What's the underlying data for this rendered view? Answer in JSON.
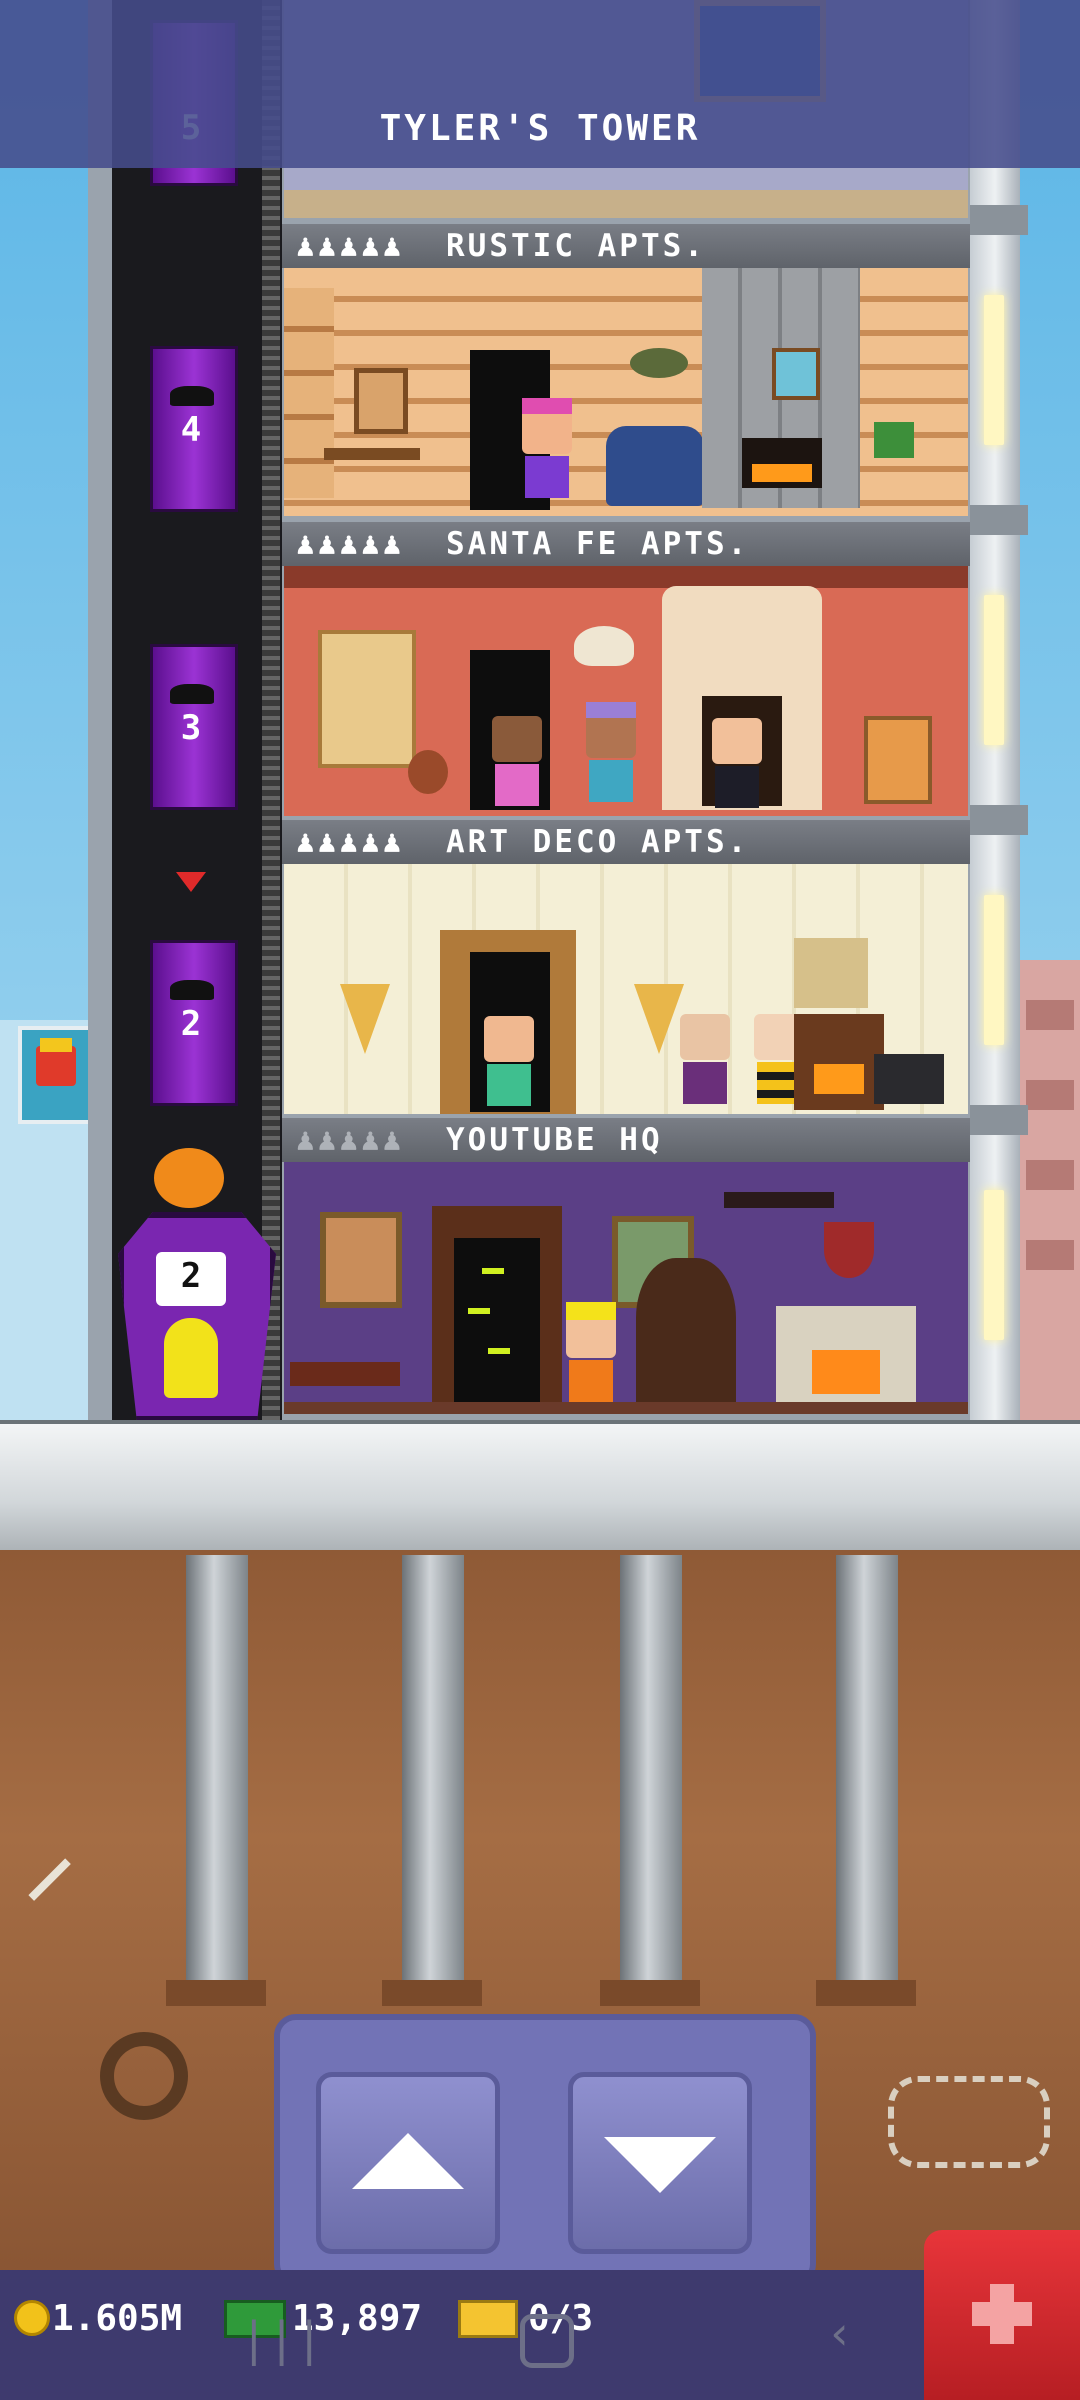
{
  "tower": {
    "title": "TYLER'S TOWER"
  },
  "floors": [
    {
      "people": "♟♟♟♟♟",
      "name": "RUSTIC APTS.",
      "elevator": "4"
    },
    {
      "people": "♟♟♟♟♟",
      "name": "SANTA FE APTS.",
      "elevator": "3"
    },
    {
      "people": "♟♟♟♟♟",
      "name": "ART DECO APTS.",
      "elevator": "2"
    },
    {
      "people": "♟♟♟♟♟",
      "name": "YOUTUBE HQ",
      "elevator": ""
    }
  ],
  "top_elevator": "5",
  "lobby_elevator": "2",
  "resources": {
    "coins": "1.605M",
    "bux": "13,897",
    "tickets": "0/3"
  },
  "controls": {
    "up_icon": "arrow-up-icon",
    "down_icon": "arrow-down-icon"
  },
  "colors": {
    "header": "#464c8c",
    "elevator": "#9b33d4",
    "red_button": "#e8353a",
    "status_bar": "#3e3a6e"
  }
}
